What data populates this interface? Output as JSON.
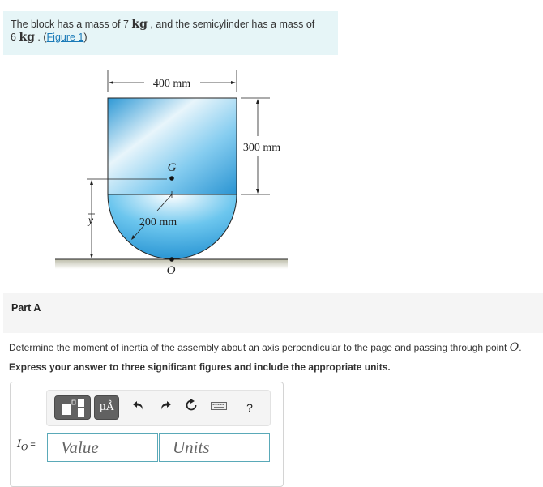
{
  "intro": {
    "text_before": "The block has a mass of 7 ",
    "unit1": "kg",
    "text_middle": " , and the semicylinder has a mass of",
    "text_line2_start": "6 ",
    "unit2": "kg",
    "text_after": " . (",
    "figure_link": "Figure 1",
    "text_close": ")"
  },
  "figure": {
    "width_label": "400 mm",
    "height_label": "300 mm",
    "radius_label": "200 mm",
    "centroid_label": "G",
    "point_label": "O",
    "ybar_label": "y",
    "colors": {
      "blue_dark": "#2f9ad6",
      "blue_light": "#e6f4fb",
      "ground": "#c9c9b8"
    }
  },
  "part": {
    "title": "Part A",
    "question": "Determine the moment of inertia of the assembly about an axis perpendicular to the page and passing through point ",
    "question_point": "O",
    "question_end": ".",
    "instruction": "Express your answer to three significant figures and include the appropriate units."
  },
  "answer": {
    "label_main": "I",
    "label_sub": "O",
    "label_eq": " =",
    "value_placeholder": "Value",
    "units_placeholder": "Units",
    "toolbar": {
      "units_button": "μÅ",
      "help": "?"
    }
  }
}
